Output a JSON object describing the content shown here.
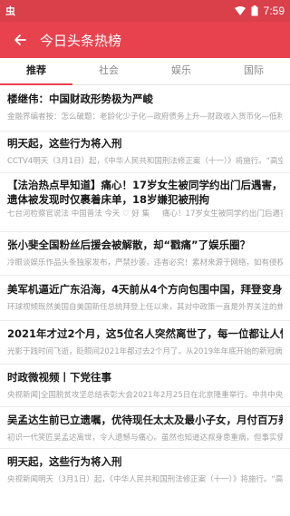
{
  "status_bar": {
    "left_icon_text": "虫",
    "time": "7:59"
  },
  "app_bar": {
    "title": "今日头条热榜"
  },
  "tabs": [
    {
      "label": "推荐",
      "active": true
    },
    {
      "label": "社会",
      "active": false
    },
    {
      "label": "娱乐",
      "active": false
    },
    {
      "label": "国际",
      "active": false
    }
  ],
  "articles": [
    {
      "title": "楼继伟：中国财政形势极为严峻",
      "summary": "金融界编者按：怎么破题：老龄化少子化—政府债务上升—财政收入货币化—低利率、货币超发—股市房市吃"
    },
    {
      "title": "明天起，这些行为将入刑",
      "summary": "CCTV4明天（3月1日）起，《中华人民共和国刑法修正案（十一）》将施行。“高空抛物罪”留名顶替罪”以"
    },
    {
      "title": "【法治热点早知道】痛心！17岁女生被同学约出门后遇害，遗体被发现时仅裹着床单，18岁嫌犯被刑拘",
      "summary": "七台河检察官说法 中国普法 今天 ♡ 好 集 　 痛心！17岁女生被同学约出门后遇害，遗体被发现时仅裹着"
    },
    {
      "title": "张小斐全国粉丝后援会被解散，却“戳痛”了娱乐圈？",
      "summary": "冷眼谈娱乐作品头条独家发布，严禁抄袭，违者必究！素材来源于网络，如有侵权请联系删除。"
    },
    {
      "title": "美军机逼近广东沿海，4天前从4个方向包围中国，拜登变身战争狂人",
      "summary": "环球视频既然美国自美国新任总统拜登上任以来，其对中政策一直是外界关注的焦点。而在最近的七国集团"
    },
    {
      "title": "2021年才过2个月，这5位名人突然离世了，每一位都让人惋惜",
      "summary": "光影于践时间飞逝，眨眼间2021年都过去2个月了。从2019年年底开始的新冠病毒让我们的生活都有了巨"
    },
    {
      "title": "时政微视频丨下党往事",
      "summary": "央视新闻|全国脱贫攻坚总结表彰大会2021年2月25日在北京隆重举行。中共中央总书记、国家主席、中央"
    },
    {
      "title": "吴孟达生前已立遗嘱，优待现任太太及最小子女，月付百万养三个家",
      "summary": "初识一代笑匠吴孟达离世，令人遗憾与痛心。虽然也知道达叔身患重病，但事实使用到情况突然恶化时还是"
    },
    {
      "title": "明天起，这些行为将入刑",
      "summary": "央视新闻明天（3月1日）起，《中华人民共和国刑法修正案（十一）》将施行。“高空抛物罪”留名顶替"
    }
  ]
}
